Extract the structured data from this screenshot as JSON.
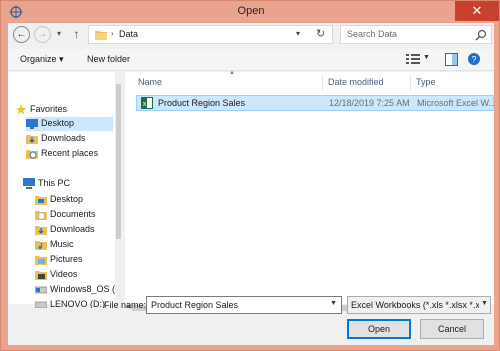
{
  "window": {
    "title": "Open"
  },
  "navbar": {
    "address_path": "Data",
    "search_placeholder": "Search Data"
  },
  "toolbar": {
    "organize_label": "Organize",
    "new_folder_label": "New folder"
  },
  "navpane": {
    "favorites_label": "Favorites",
    "favorites": [
      {
        "label": "Desktop",
        "icon": "desktop-icon"
      },
      {
        "label": "Downloads",
        "icon": "downloads-icon"
      },
      {
        "label": "Recent places",
        "icon": "recent-places-icon"
      }
    ],
    "thispc_label": "This PC",
    "thispc": [
      {
        "label": "Desktop",
        "icon": "folder-icon"
      },
      {
        "label": "Documents",
        "icon": "folder-icon"
      },
      {
        "label": "Downloads",
        "icon": "downloads-icon"
      },
      {
        "label": "Music",
        "icon": "music-icon"
      },
      {
        "label": "Pictures",
        "icon": "pictures-icon"
      },
      {
        "label": "Videos",
        "icon": "videos-icon"
      },
      {
        "label": "Windows8_OS (C",
        "icon": "drive-icon"
      },
      {
        "label": "LENOVO (D:)",
        "icon": "drive-icon"
      }
    ]
  },
  "filelist": {
    "columns": {
      "name": "Name",
      "date": "Date modified",
      "type": "Type"
    },
    "files": [
      {
        "name": "Product Region Sales",
        "date": "12/18/2019 7:25 AM",
        "type": "Microsoft Excel W..."
      }
    ]
  },
  "bottom": {
    "file_name_label": "File name:",
    "file_name_value": "Product Region Sales",
    "filter_value": "Excel Workbooks (*.xls *.xlsx *.xl",
    "open_label": "Open",
    "cancel_label": "Cancel"
  },
  "colors": {
    "titlebar": "#eaa48e",
    "close_button": "#c7412d",
    "selection": "#cce8ff",
    "accent": "#0078d7"
  }
}
